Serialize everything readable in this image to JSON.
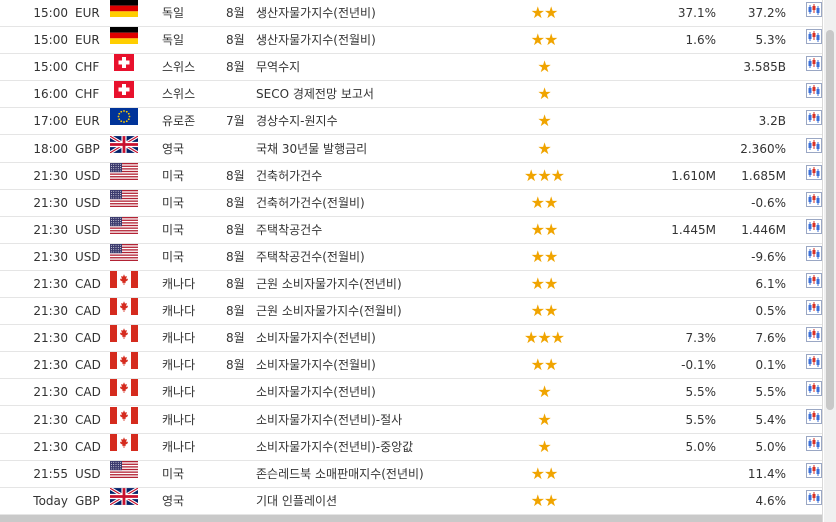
{
  "rows": [
    {
      "time": "15:00",
      "currency": "EUR",
      "flag": "germany-flag",
      "country": "독일",
      "month": "8월",
      "event": "생산자물가지수(전년비)",
      "importance": 2,
      "actual": "37.1%",
      "previous": "37.2%"
    },
    {
      "time": "15:00",
      "currency": "EUR",
      "flag": "germany-flag",
      "country": "독일",
      "month": "8월",
      "event": "생산자물가지수(전월비)",
      "importance": 2,
      "actual": "1.6%",
      "previous": "5.3%"
    },
    {
      "time": "15:00",
      "currency": "CHF",
      "flag": "switzerland-flag",
      "country": "스위스",
      "month": "8월",
      "event": "무역수지",
      "importance": 1,
      "actual": "",
      "previous": "3.585B"
    },
    {
      "time": "16:00",
      "currency": "CHF",
      "flag": "switzerland-flag",
      "country": "스위스",
      "month": "",
      "event": "SECO 경제전망 보고서",
      "importance": 1,
      "actual": "",
      "previous": ""
    },
    {
      "time": "17:00",
      "currency": "EUR",
      "flag": "eu-flag",
      "country": "유로존",
      "month": "7월",
      "event": "경상수지-원지수",
      "importance": 1,
      "actual": "",
      "previous": "3.2B"
    },
    {
      "time": "18:00",
      "currency": "GBP",
      "flag": "uk-flag",
      "country": "영국",
      "month": "",
      "event": "국채 30년물 발행금리",
      "importance": 1,
      "actual": "",
      "previous": "2.360%"
    },
    {
      "time": "21:30",
      "currency": "USD",
      "flag": "usa-flag",
      "country": "미국",
      "month": "8월",
      "event": "건축허가건수",
      "importance": 3,
      "actual": "1.610M",
      "previous": "1.685M"
    },
    {
      "time": "21:30",
      "currency": "USD",
      "flag": "usa-flag",
      "country": "미국",
      "month": "8월",
      "event": "건축허가건수(전월비)",
      "importance": 2,
      "actual": "",
      "previous": "-0.6%"
    },
    {
      "time": "21:30",
      "currency": "USD",
      "flag": "usa-flag",
      "country": "미국",
      "month": "8월",
      "event": "주택착공건수",
      "importance": 2,
      "actual": "1.445M",
      "previous": "1.446M"
    },
    {
      "time": "21:30",
      "currency": "USD",
      "flag": "usa-flag",
      "country": "미국",
      "month": "8월",
      "event": "주택착공건수(전월비)",
      "importance": 2,
      "actual": "",
      "previous": "-9.6%"
    },
    {
      "time": "21:30",
      "currency": "CAD",
      "flag": "canada-flag",
      "country": "캐나다",
      "month": "8월",
      "event": "근원 소비자물가지수(전년비)",
      "importance": 2,
      "actual": "",
      "previous": "6.1%"
    },
    {
      "time": "21:30",
      "currency": "CAD",
      "flag": "canada-flag",
      "country": "캐나다",
      "month": "8월",
      "event": "근원 소비자물가지수(전월비)",
      "importance": 2,
      "actual": "",
      "previous": "0.5%"
    },
    {
      "time": "21:30",
      "currency": "CAD",
      "flag": "canada-flag",
      "country": "캐나다",
      "month": "8월",
      "event": "소비자물가지수(전년비)",
      "importance": 3,
      "actual": "7.3%",
      "previous": "7.6%"
    },
    {
      "time": "21:30",
      "currency": "CAD",
      "flag": "canada-flag",
      "country": "캐나다",
      "month": "8월",
      "event": "소비자물가지수(전월비)",
      "importance": 2,
      "actual": "-0.1%",
      "previous": "0.1%"
    },
    {
      "time": "21:30",
      "currency": "CAD",
      "flag": "canada-flag",
      "country": "캐나다",
      "month": "",
      "event": "소비자물가지수(전년비)",
      "importance": 1,
      "actual": "5.5%",
      "previous": "5.5%"
    },
    {
      "time": "21:30",
      "currency": "CAD",
      "flag": "canada-flag",
      "country": "캐나다",
      "month": "",
      "event": "소비자물가지수(전년비)-절사",
      "importance": 1,
      "actual": "5.5%",
      "previous": "5.4%"
    },
    {
      "time": "21:30",
      "currency": "CAD",
      "flag": "canada-flag",
      "country": "캐나다",
      "month": "",
      "event": "소비자물가지수(전년비)-중앙값",
      "importance": 1,
      "actual": "5.0%",
      "previous": "5.0%"
    },
    {
      "time": "21:55",
      "currency": "USD",
      "flag": "usa-flag",
      "country": "미국",
      "month": "",
      "event": "존슨레드북 소매판매지수(전년비)",
      "importance": 2,
      "actual": "",
      "previous": "11.4%"
    },
    {
      "time": "Today",
      "currency": "GBP",
      "flag": "uk-flag",
      "country": "영국",
      "month": "",
      "event": "기대 인플레이션",
      "importance": 2,
      "actual": "",
      "previous": "4.6%"
    }
  ],
  "colors": {
    "star": "#f0a400",
    "row_border": "#e5e5e5",
    "chart_icon_blue": "#3a6fd8",
    "chart_icon_red": "#d93025"
  },
  "icons": {
    "importance": "star-icon",
    "chart": "chart-icon"
  }
}
